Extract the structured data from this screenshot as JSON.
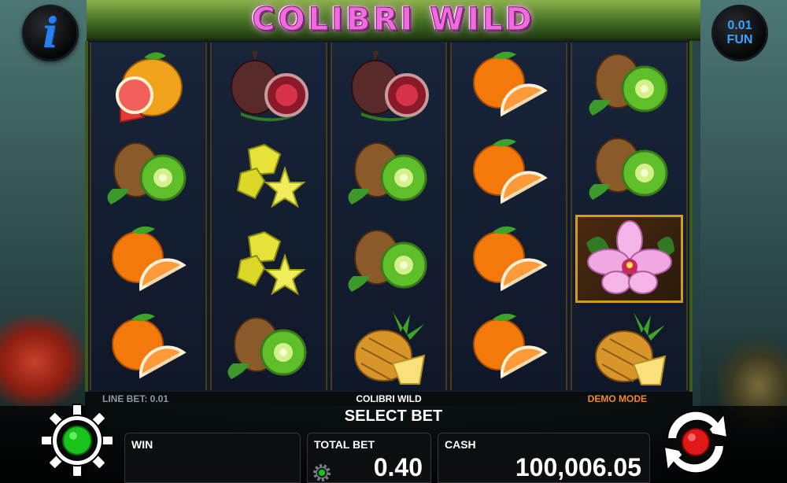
{
  "game": {
    "title": "COLIBRI WILD",
    "denomination_value": "0.01",
    "denomination_currency": "FUN"
  },
  "info_button": {
    "label": "i"
  },
  "reels": [
    [
      "grapefruit",
      "kiwi",
      "orange",
      "orange"
    ],
    [
      "fig",
      "starfruit",
      "starfruit",
      "kiwi"
    ],
    [
      "fig",
      "kiwi",
      "kiwi",
      "pineapple"
    ],
    [
      "orange",
      "orange",
      "orange",
      "orange"
    ],
    [
      "kiwi",
      "kiwi",
      "orchid-wild",
      "pineapple"
    ]
  ],
  "info_strip": {
    "line_bet": "LINE BET: 0.01",
    "game_name": "COLIBRI WILD",
    "demo_mode": "DEMO MODE"
  },
  "bottom": {
    "select_bet": "SELECT BET",
    "win_label": "WIN",
    "win_value": "",
    "total_bet_label": "TOTAL BET",
    "total_bet_value": "0.40",
    "cash_label": "CASH",
    "cash_value": "100,006.05"
  },
  "colors": {
    "title": "#f26adf",
    "demo_mode": "#f08a20",
    "denomination": "#3aa4ff",
    "settings_light": "#18c41c",
    "spin_light": "#e01818"
  },
  "icons": {
    "settings": "gear-icon",
    "spin": "spin-arrows-icon",
    "info": "info-icon"
  }
}
